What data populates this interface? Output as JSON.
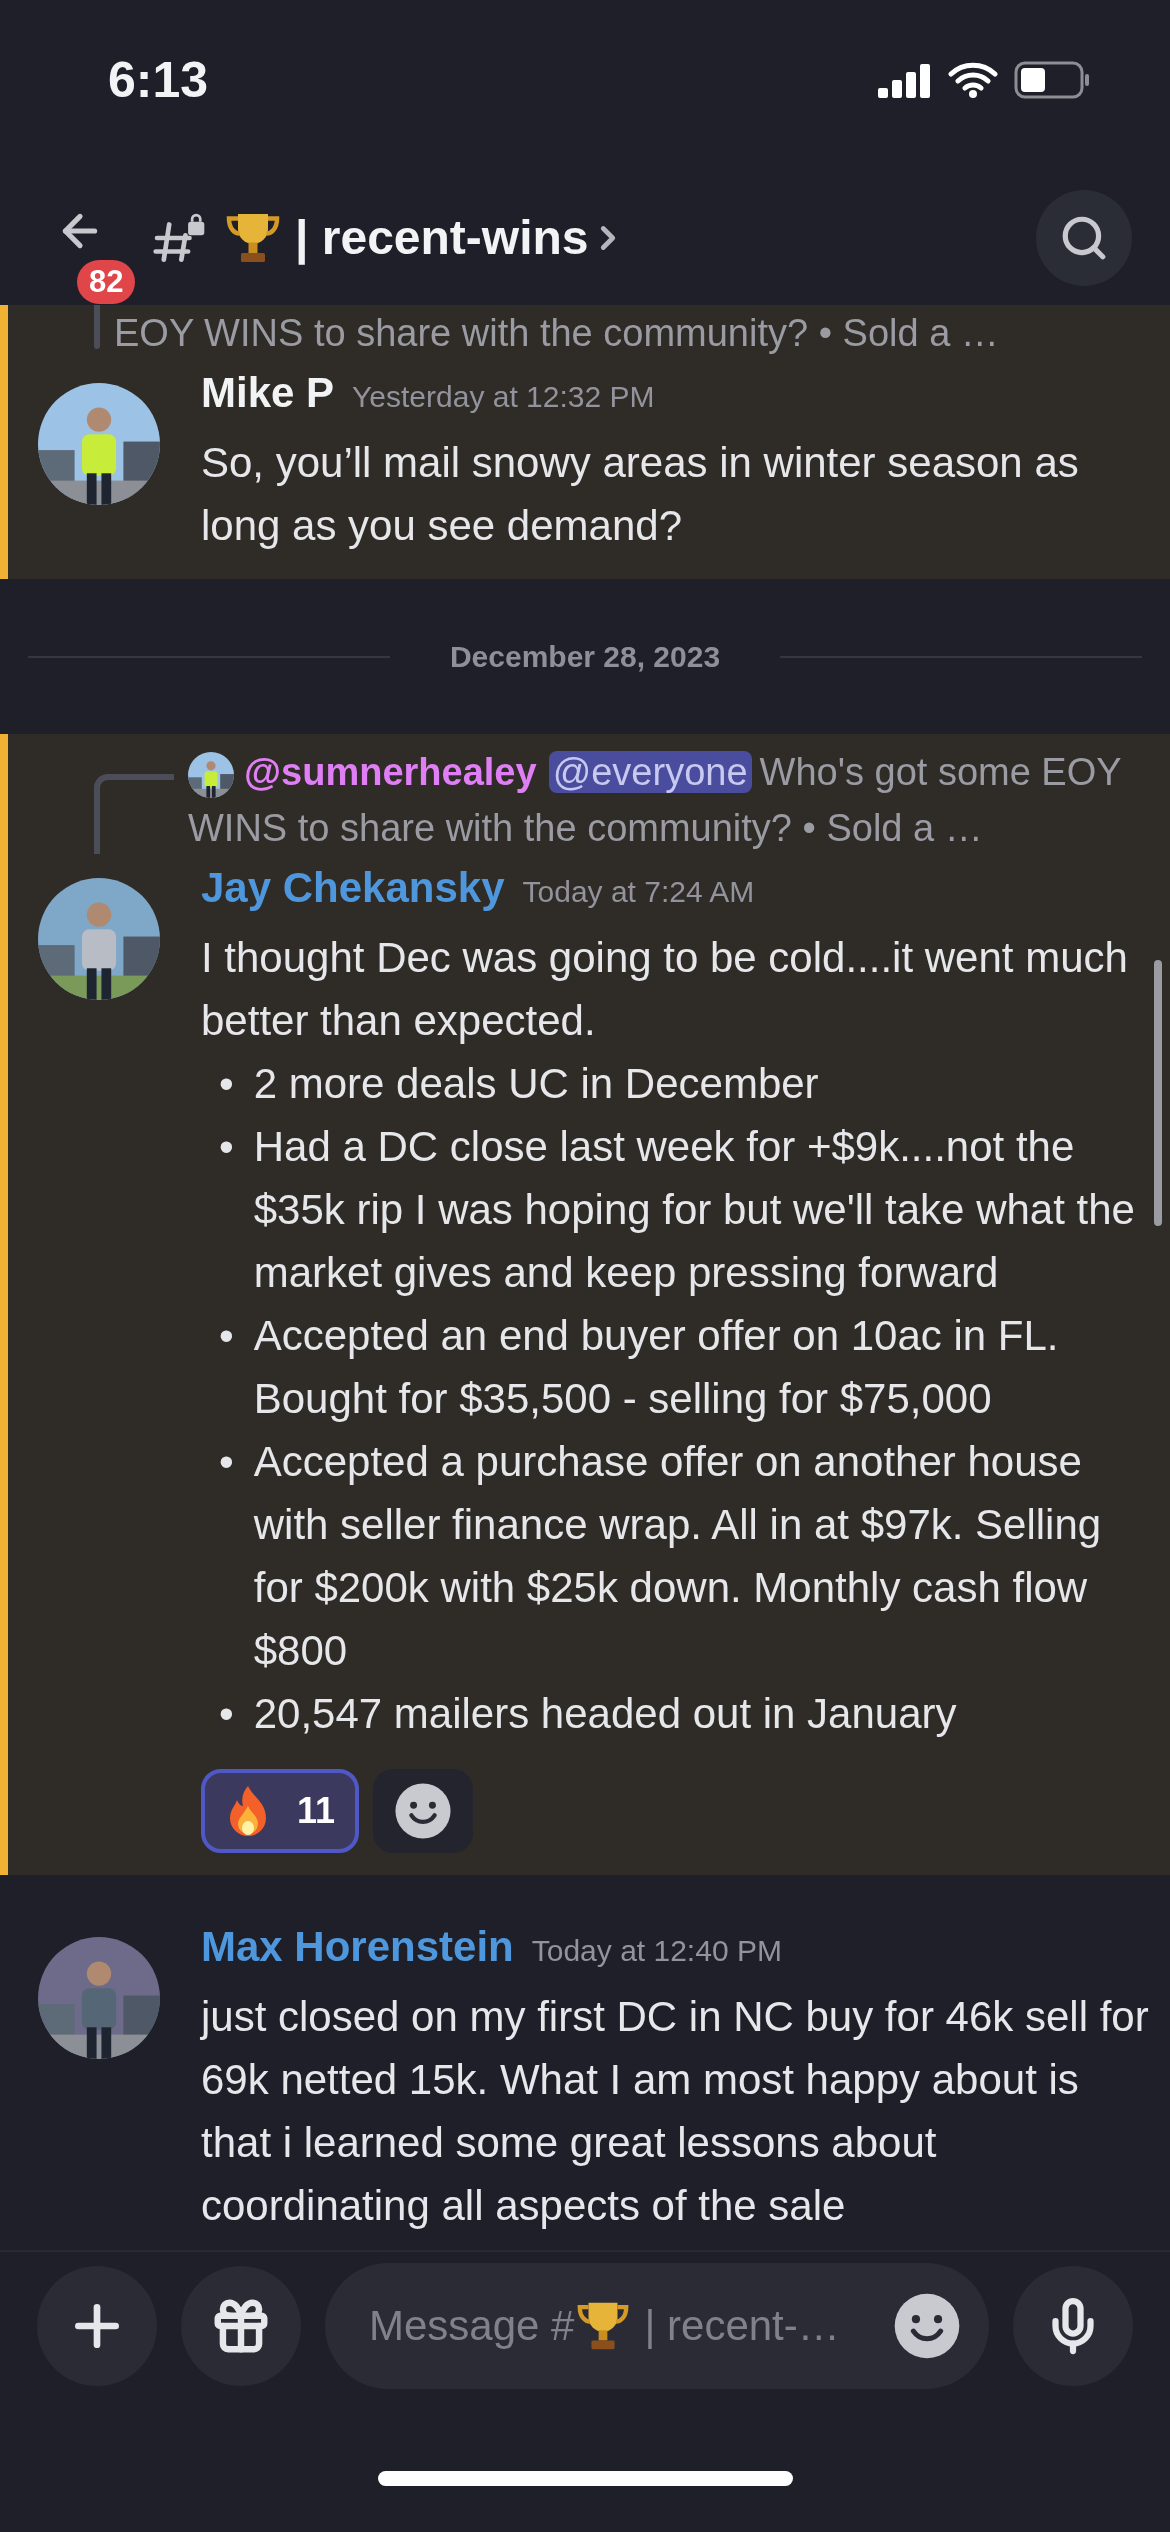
{
  "status_bar": {
    "time": "6:13"
  },
  "header": {
    "unread_badge": "82",
    "channel_name": "| recent-wins"
  },
  "feed": [
    {
      "kind": "message",
      "highlighted": true,
      "reply": {
        "text": "EOY WINS to share with the community?  •  Sold a …"
      },
      "author": "Mike P",
      "color": "#f2f3f5",
      "timestamp": "Yesterday at 12:32 PM",
      "paragraphs": [
        "So, you’ll mail snowy areas in winter season as long as you see demand?"
      ]
    },
    {
      "kind": "date_divider",
      "label": "December 28, 2023"
    },
    {
      "kind": "message",
      "highlighted": true,
      "reply": {
        "author": "@sumnerhealey",
        "color": "#e07ff5",
        "mention": "@everyone",
        "text": "Who's got some EOY WINS to share with the community?  •  Sold a …"
      },
      "author": "Jay Chekansky",
      "color": "#4f97dc",
      "timestamp": "Today at 7:24 AM",
      "paragraphs": [
        "I thought Dec was going to be cold....it went much better than expected."
      ],
      "bullets": [
        {
          "marker": "•",
          "text": "2 more deals UC in December"
        },
        {
          "marker": "•",
          "text": "Had a DC close last week for +$9k....not the $35k rip I was hoping for but we'll take what the market gives and keep pressing forward"
        },
        {
          "marker": "•",
          "text": "Accepted an end buyer offer on 10ac in FL. Bought for $35,500 - selling for $75,000"
        },
        {
          "marker": "•",
          "text": "Accepted a purchase offer on another house with seller finance wrap.  All in at $97k.  Selling for $200k with $25k down.  Monthly cash flow $800"
        },
        {
          "marker": "•",
          "text": "20,547 mailers headed out in January"
        }
      ],
      "reactions": [
        {
          "count": "11",
          "selected": true
        }
      ]
    },
    {
      "kind": "message",
      "highlighted": false,
      "author": "Max Horenstein",
      "color": "#4f97dc",
      "timestamp": "Today at 12:40 PM",
      "paragraphs": [
        "just closed on my first DC in NC buy for 46k sell for 69k netted 15k. What I am most happy about is that i learned some great lessons about coordinating all aspects of the sale"
      ]
    }
  ],
  "composer": {
    "placeholder": "Message #",
    "placeholder_rest": "| recent-…"
  }
}
